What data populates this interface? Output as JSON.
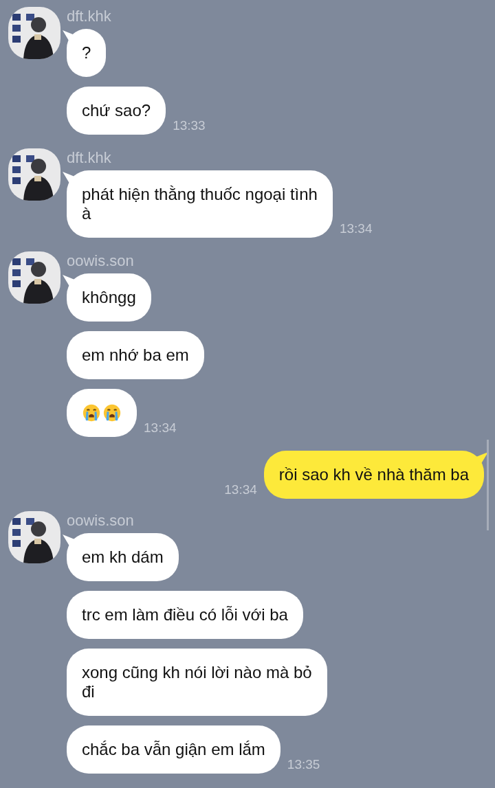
{
  "groups": [
    {
      "outgoing": false,
      "sender": "dft.khk",
      "messages": [
        {
          "kind": "text",
          "text": "?"
        },
        {
          "kind": "text",
          "text": "chứ sao?",
          "time": "13:33"
        }
      ]
    },
    {
      "outgoing": false,
      "sender": "dft.khk",
      "messages": [
        {
          "kind": "text",
          "text": "phát hiện thằng thuốc ngoại tình\nà",
          "time": "13:34"
        }
      ]
    },
    {
      "outgoing": false,
      "sender": "oowis.son",
      "messages": [
        {
          "kind": "text",
          "text": "khôngg"
        },
        {
          "kind": "text",
          "text": "em nhớ ba em"
        },
        {
          "kind": "emoji",
          "icons": [
            {
              "kind": "crying"
            },
            {
              "kind": "crying"
            }
          ],
          "time": "13:34"
        }
      ]
    },
    {
      "outgoing": true,
      "messages": [
        {
          "kind": "text",
          "text": "rồi sao kh về nhà thăm ba",
          "time": "13:34"
        }
      ]
    },
    {
      "outgoing": false,
      "sender": "oowis.son",
      "messages": [
        {
          "kind": "text",
          "text": "em kh dám"
        },
        {
          "kind": "text",
          "text": "trc em làm điều có lỗi với ba"
        },
        {
          "kind": "text",
          "text": "xong cũng kh nói lời nào mà bỏ\nđi"
        },
        {
          "kind": "text",
          "text": "chắc ba vẫn giận em lắm",
          "time": "13:35"
        }
      ]
    }
  ]
}
